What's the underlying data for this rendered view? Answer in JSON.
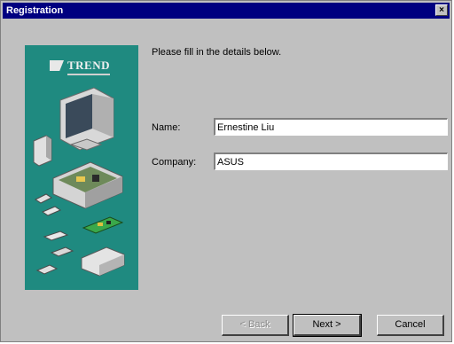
{
  "window": {
    "title": "Registration",
    "close_glyph": "×"
  },
  "sidebar": {
    "logo_text": "TREND",
    "panel_color": "#1f8a80"
  },
  "form": {
    "prompt": "Please fill in the details below.",
    "name_label": "Name:",
    "name_value": "Ernestine Liu",
    "company_label": "Company:",
    "company_value": "ASUS"
  },
  "buttons": {
    "back": "< Back",
    "next": "Next >",
    "cancel": "Cancel"
  },
  "icons": [
    "close-icon",
    "trend-logo",
    "computer-monitor-icon",
    "pc-case-icon",
    "circuit-board-icon",
    "memory-chip-icon",
    "mouse-icon",
    "speaker-icon",
    "drive-icon"
  ]
}
